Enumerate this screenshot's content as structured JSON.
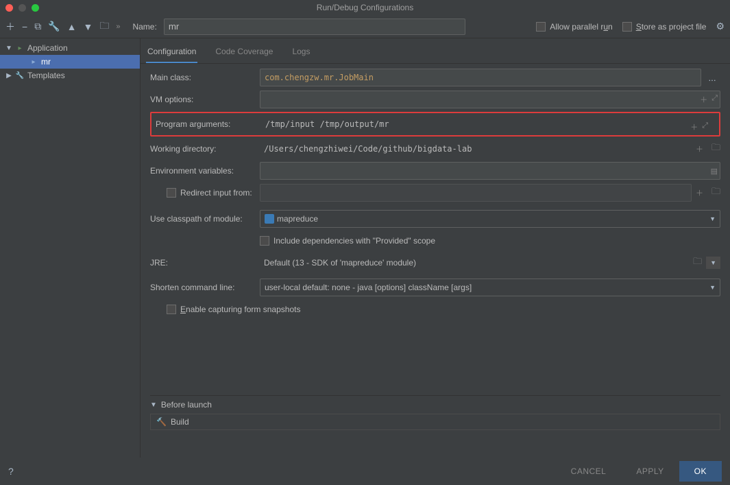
{
  "window": {
    "title": "Run/Debug Configurations"
  },
  "toolbar": {
    "name_label": "Name:",
    "name_value": "mr",
    "allow_parallel": "Allow parallel run",
    "store_project": "Store as project file"
  },
  "sidebar": {
    "application": "Application",
    "config_name": "mr",
    "templates": "Templates"
  },
  "tabs": {
    "configuration": "Configuration",
    "code_coverage": "Code Coverage",
    "logs": "Logs"
  },
  "form": {
    "main_class_label": "Main class:",
    "main_class_value": "com.chengzw.mr.JobMain",
    "vm_options_label": "VM options:",
    "program_args_label": "Program arguments:",
    "program_args_value": "/tmp/input /tmp/output/mr",
    "working_dir_label": "Working directory:",
    "working_dir_value": "/Users/chengzhiwei/Code/github/bigdata-lab",
    "env_vars_label": "Environment variables:",
    "redirect_label": "Redirect input from:",
    "classpath_label": "Use classpath of module:",
    "classpath_value": "mapreduce",
    "include_deps_label": "Include dependencies with \"Provided\" scope",
    "jre_label": "JRE:",
    "jre_value": "Default (13 - SDK of 'mapreduce' module)",
    "shorten_label": "Shorten command line:",
    "shorten_value": "user-local default: none - java [options] className [args]",
    "enable_snapshots_label": "Enable capturing form snapshots"
  },
  "before_launch": {
    "header": "Before launch",
    "build": "Build"
  },
  "footer": {
    "cancel": "CANCEL",
    "apply": "APPLY",
    "ok": "OK"
  }
}
